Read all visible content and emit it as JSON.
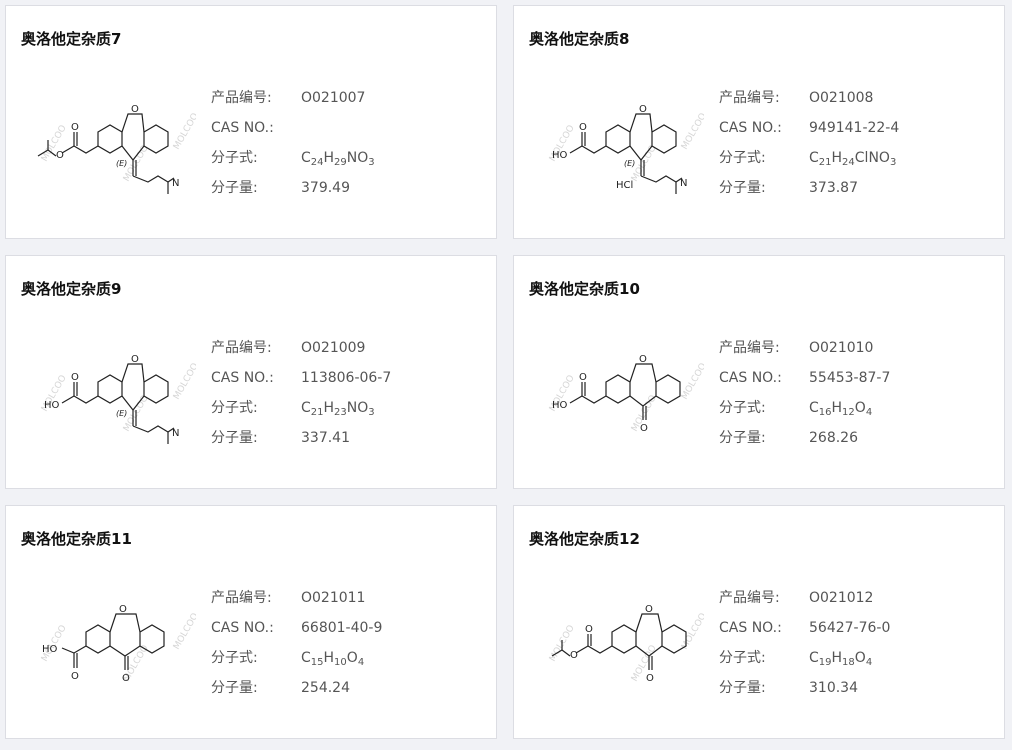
{
  "labels": {
    "product_no": "产品编号:",
    "cas_no": "CAS NO.:",
    "formula": "分子式:",
    "mol_weight": "分子量:"
  },
  "watermark": "MOLCOO",
  "products": [
    {
      "title": "奥洛他定杂质7",
      "product_no": "O021007",
      "cas_no": "",
      "formula": [
        {
          "t": "C"
        },
        {
          "s": "24"
        },
        {
          "t": "H"
        },
        {
          "s": "29"
        },
        {
          "t": "NO"
        },
        {
          "s": "3"
        }
      ],
      "mol_weight": "379.49",
      "atoms": [
        {
          "text": "O",
          "cls": "atom"
        },
        {
          "text": "O",
          "cls": "atom"
        },
        {
          "text": "O",
          "cls": "atom"
        },
        {
          "text": "(E)",
          "cls": "atom-i"
        },
        {
          "text": "N",
          "cls": "atom"
        }
      ]
    },
    {
      "title": "奥洛他定杂质8",
      "product_no": "O021008",
      "cas_no": "949141-22-4",
      "formula": [
        {
          "t": "C"
        },
        {
          "s": "21"
        },
        {
          "t": "H"
        },
        {
          "s": "24"
        },
        {
          "t": "ClNO"
        },
        {
          "s": "3"
        }
      ],
      "mol_weight": "373.87",
      "atoms": [
        {
          "text": "O",
          "cls": "atom"
        },
        {
          "text": "O",
          "cls": "atom"
        },
        {
          "text": "HO",
          "cls": "atom"
        },
        {
          "text": "(E)",
          "cls": "atom-i"
        },
        {
          "text": "HCl",
          "cls": "atom"
        },
        {
          "text": "N",
          "cls": "atom"
        }
      ]
    },
    {
      "title": "奥洛他定杂质9",
      "product_no": "O021009",
      "cas_no": "113806-06-7",
      "formula": [
        {
          "t": "C"
        },
        {
          "s": "21"
        },
        {
          "t": "H"
        },
        {
          "s": "23"
        },
        {
          "t": "NO"
        },
        {
          "s": "3"
        }
      ],
      "mol_weight": "337.41",
      "atoms": [
        {
          "text": "O",
          "cls": "atom"
        },
        {
          "text": "O",
          "cls": "atom"
        },
        {
          "text": "HO",
          "cls": "atom"
        },
        {
          "text": "(E)",
          "cls": "atom-i"
        },
        {
          "text": "N",
          "cls": "atom"
        }
      ]
    },
    {
      "title": "奥洛他定杂质10",
      "product_no": "O021010",
      "cas_no": "55453-87-7",
      "formula": [
        {
          "t": "C"
        },
        {
          "s": "16"
        },
        {
          "t": "H"
        },
        {
          "s": "12"
        },
        {
          "t": "O"
        },
        {
          "s": "4"
        }
      ],
      "mol_weight": "268.26",
      "atoms": [
        {
          "text": "O",
          "cls": "atom"
        },
        {
          "text": "O",
          "cls": "atom"
        },
        {
          "text": "HO",
          "cls": "atom"
        },
        {
          "text": "O",
          "cls": "atom"
        }
      ]
    },
    {
      "title": "奥洛他定杂质11",
      "product_no": "O021011",
      "cas_no": "66801-40-9",
      "formula": [
        {
          "t": "C"
        },
        {
          "s": "15"
        },
        {
          "t": "H"
        },
        {
          "s": "10"
        },
        {
          "t": "O"
        },
        {
          "s": "4"
        }
      ],
      "mol_weight": "254.24",
      "atoms": [
        {
          "text": "O",
          "cls": "atom"
        },
        {
          "text": "HO",
          "cls": "atom"
        },
        {
          "text": "O",
          "cls": "atom"
        },
        {
          "text": "O",
          "cls": "atom"
        }
      ]
    },
    {
      "title": "奥洛他定杂质12",
      "product_no": "O021012",
      "cas_no": "56427-76-0",
      "formula": [
        {
          "t": "C"
        },
        {
          "s": "19"
        },
        {
          "t": "H"
        },
        {
          "s": "18"
        },
        {
          "t": "O"
        },
        {
          "s": "4"
        }
      ],
      "mol_weight": "310.34",
      "atoms": [
        {
          "text": "O",
          "cls": "atom"
        },
        {
          "text": "O",
          "cls": "atom"
        },
        {
          "text": "O",
          "cls": "atom"
        },
        {
          "text": "O",
          "cls": "atom"
        }
      ]
    }
  ]
}
